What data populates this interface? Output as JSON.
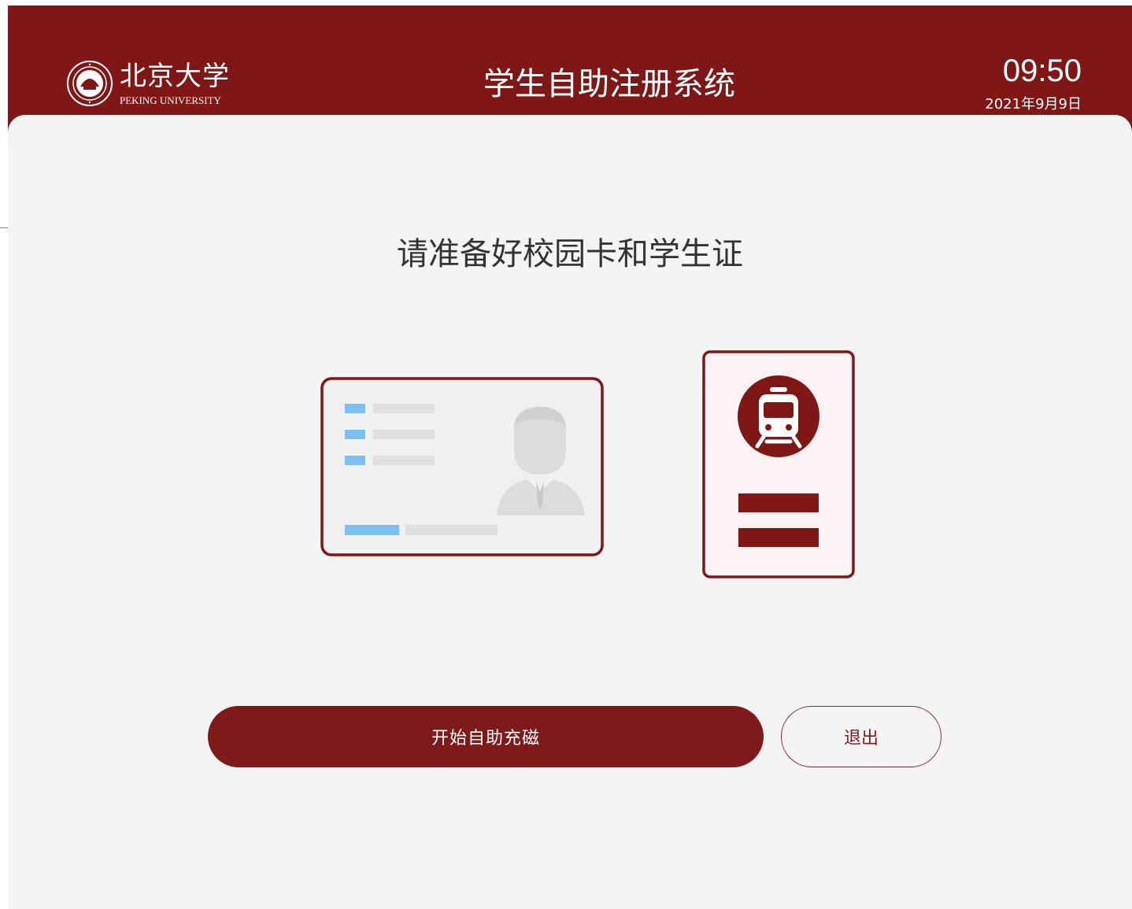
{
  "header": {
    "logo_cn": "北京大学",
    "logo_en": "PEKING UNIVERSITY",
    "title": "学生自助注册系统",
    "time": "09:50",
    "date": "2021年9月9日"
  },
  "main": {
    "prompt": "请准备好校园卡和学生证"
  },
  "actions": {
    "start_label": "开始自助充磁",
    "exit_label": "退出"
  },
  "colors": {
    "brand": "#7f1716",
    "background": "#f4f4f4",
    "accent_blue": "#7cc0f5"
  },
  "icons": {
    "logo": "peking-university-seal-icon",
    "campus_card": "campus-card-icon",
    "student_card": "student-id-card-icon",
    "train": "train-icon",
    "person": "person-avatar-icon"
  }
}
